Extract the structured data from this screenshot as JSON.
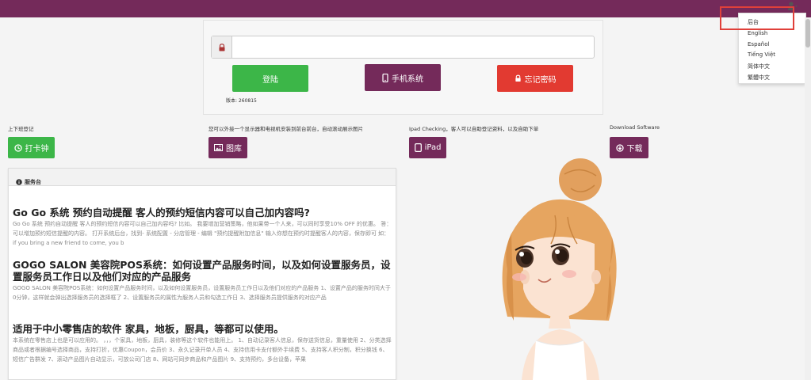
{
  "user_menu": {
    "items": [
      "后台",
      "English",
      "Español",
      "Tiếng Việt",
      "简体中文",
      "繁體中文"
    ]
  },
  "login": {
    "password_value": "",
    "login_label": "登陆",
    "mobile_label": "手机系统",
    "forgot_label": "忘记密码",
    "version": "版本: 260815"
  },
  "columns": [
    {
      "label": "上下班登记",
      "button": "打卡钟"
    },
    {
      "label": "您可以外接一个显示器和电视机安装到前台前台，自动滚动展示图片",
      "button": "图库"
    },
    {
      "label": "Ipad Checking，客人可以自助登记资料，以及自助下单",
      "button": "iPad"
    },
    {
      "label": "Download Software",
      "button": "下载"
    }
  ],
  "news": {
    "header": "服务台",
    "articles": [
      {
        "title": "Go Go 系统 预约自动提醒 客人的预约短信内容可以自己加内容吗?",
        "body": "Go Go 系统 预约自动提醒 客人的预约短信内容可以自己加内容吗? 比如。 我要增加营销策略，他如果带一个人来，可以同时享受10% OFF 的优惠。 答： 可以增加预约短信提醒的内容。 打开系统后台，找到- 系统配置 - 分店管理 - 编辑 \"预约提醒附加信息\" 输入你想在预约时提醒客人的内容，保存即可 如： if you bring a new friend to come, you b"
      },
      {
        "title": "GOGO SALON 美容院POS系统：如何设置产品服务时间，以及如何设置服务员，设置服务员工作日以及他们对应的产品服务",
        "body": "GOGO SALON 美容院POS系统：如何设置产品服务时间，以及如何设置服务员，设置服务员工作日以及他们对应的产品服务 1、设置产品的服务时间大于0分钟，这样就会弹出选择服务员的选择框了 2、设置服务员的属性为服务人员和勾选工作日 3、选择服务员提供服务的对应产品"
      },
      {
        "title": "适用于中小零售店的软件 家具，地板，厨具，等都可以使用。",
        "body": "本系统在零售店上也是可以应用的。 ，，，个家具，地板，厨具，装修等这个软件也能用上。 1、自动记录客人信息，保存送货信息，重量使用 2、分类选择商品或者根据编号选择商品，支持打折，优惠Coupon，会员价 3、永久记录开单人员 4、支持信用卡支付额外手续费 5、支持客人积分制，积分换钱 6、短信广告群发 7、滚动产品图片自动显示，可放公司门店 8、网站可同步商品和产品图片 9、支持预约，多台设备，苹果"
      }
    ]
  }
}
